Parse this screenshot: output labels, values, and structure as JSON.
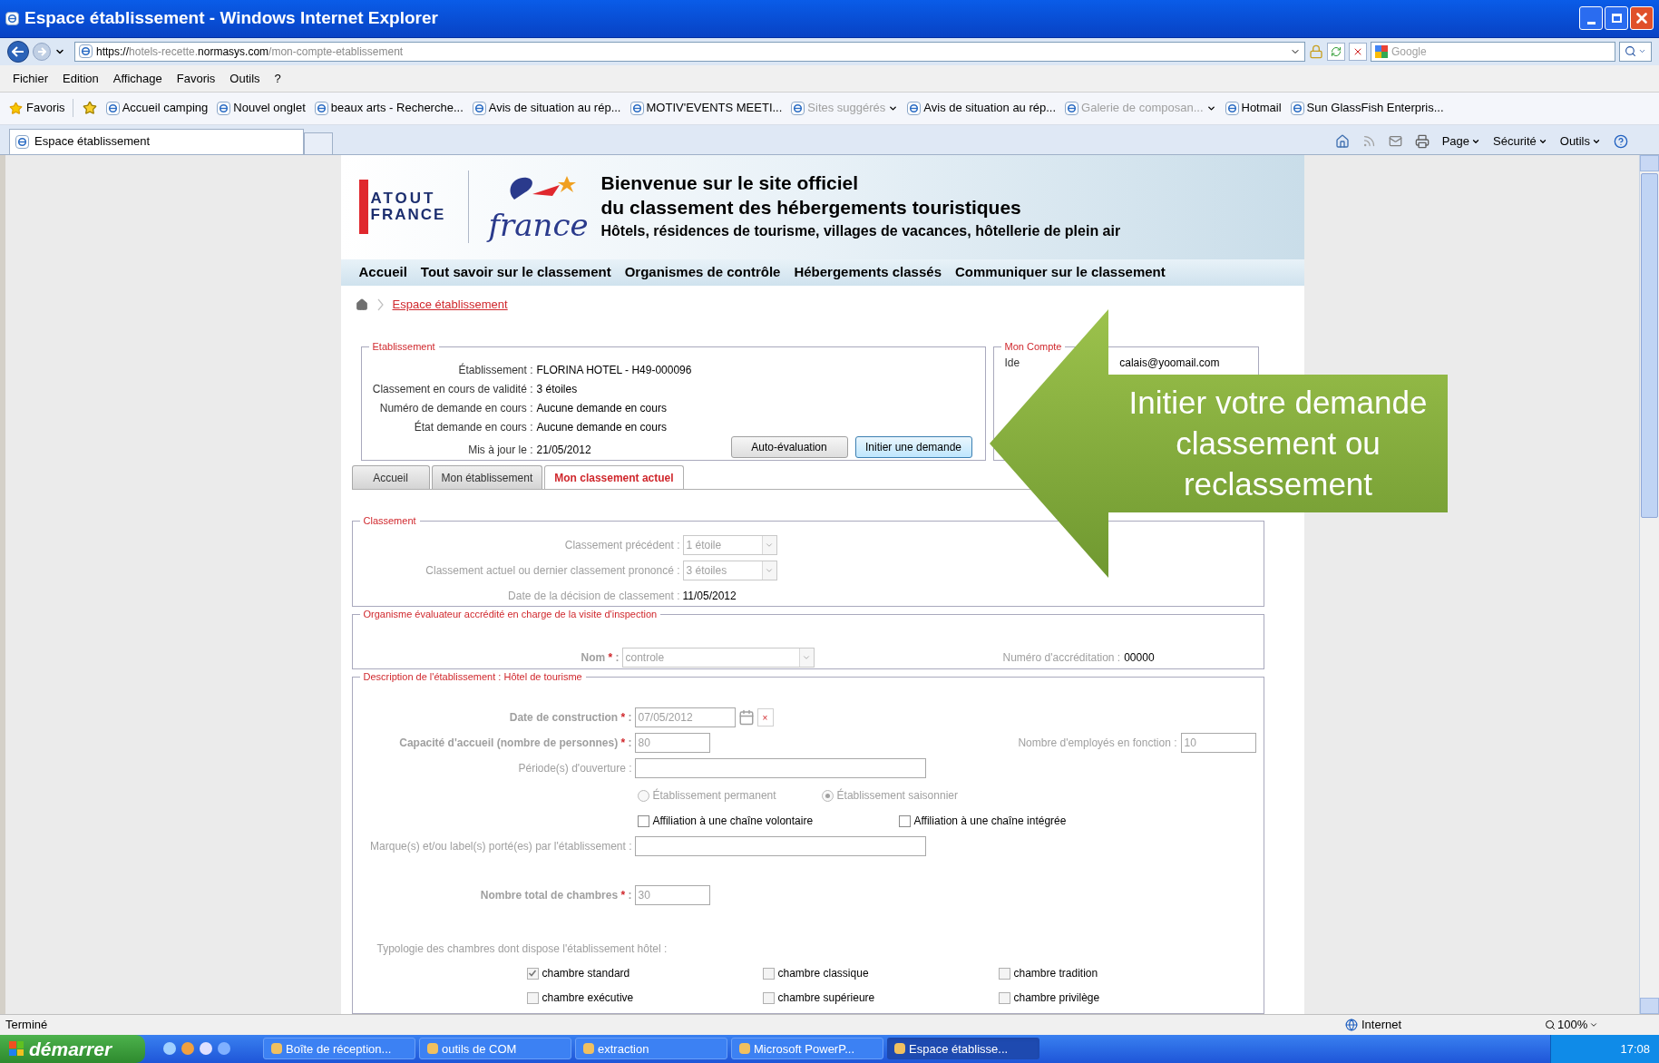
{
  "window": {
    "title": "Espace établissement - Windows Internet Explorer"
  },
  "address_bar": {
    "url_parts": [
      {
        "text": "https://",
        "dim": false
      },
      {
        "text": "hotels-recette.",
        "dim": true
      },
      {
        "text": "normasys.com",
        "dim": false
      },
      {
        "text": "/mon-compte-etablissement",
        "dim": true
      }
    ],
    "search_placeholder": "Google"
  },
  "menu": [
    "Fichier",
    "Edition",
    "Affichage",
    "Favoris",
    "Outils",
    "?"
  ],
  "favorites_bar": {
    "label": "Favoris",
    "items": [
      {
        "label": "Accueil camping",
        "disabled": false,
        "dropdown": false
      },
      {
        "label": "Nouvel onglet",
        "disabled": false,
        "dropdown": false
      },
      {
        "label": "beaux arts - Recherche...",
        "disabled": false,
        "dropdown": false
      },
      {
        "label": "Avis de situation au rép...",
        "disabled": false,
        "dropdown": false
      },
      {
        "label": "MOTIV'EVENTS MEETI...",
        "disabled": false,
        "dropdown": false
      },
      {
        "label": "Sites suggérés",
        "disabled": true,
        "dropdown": true
      },
      {
        "label": "Avis de situation au rép...",
        "disabled": false,
        "dropdown": false
      },
      {
        "label": "Galerie de composan...",
        "disabled": true,
        "dropdown": true
      },
      {
        "label": "Hotmail",
        "disabled": false,
        "dropdown": false
      },
      {
        "label": "Sun GlassFish Enterpris...",
        "disabled": false,
        "dropdown": false
      }
    ]
  },
  "browser_tabs": [
    {
      "label": "Espace établissement",
      "selected": true
    }
  ],
  "command_bar": [
    "Page",
    "Sécurité",
    "Outils"
  ],
  "site": {
    "logo": {
      "line_1": "ATOUT",
      "line_2": "FRANCE",
      "script": "france"
    },
    "header_lines": [
      "Bienvenue sur le site officiel",
      "du classement des hébergements touristiques",
      "Hôtels, résidences de tourisme, villages de vacances, hôtellerie de plein air"
    ],
    "nav": [
      "Accueil",
      "Tout savoir sur le classement",
      "Organismes de contrôle",
      "Hébergements classés",
      "Communiquer sur le classement"
    ],
    "breadcrumb": "Espace établissement",
    "etablissement": {
      "legend": "Etablissement",
      "rows": [
        {
          "label": "Établissement :",
          "value": "FLORINA HOTEL - H49-000096"
        },
        {
          "label": "Classement en cours de validité :",
          "value": "3 étoiles"
        },
        {
          "label": "Numéro de demande en cours :",
          "value": "Aucune demande en cours"
        },
        {
          "label": "État demande en cours :",
          "value": "Aucune demande en cours"
        },
        {
          "label": "Mis à jour le :",
          "value": "21/05/2012"
        }
      ],
      "buttons": [
        {
          "label": "Auto-évaluation",
          "focused": false
        },
        {
          "label": "Initier une demande",
          "focused": true
        }
      ]
    },
    "mon_compte": {
      "legend": "Mon Compte",
      "label_fragment": "Ide",
      "value_fragment": "calais@yoomail.com"
    },
    "tabs": [
      {
        "label": "Accueil",
        "selected": false
      },
      {
        "label": "Mon établissement",
        "selected": false
      },
      {
        "label": "Mon classement actuel",
        "selected": true
      }
    ],
    "classement": {
      "legend": "Classement",
      "rows": [
        {
          "kind": "select",
          "label": "Classement précédent :",
          "value": "1 étoile"
        },
        {
          "kind": "select",
          "label": "Classement actuel ou dernier classement prononcé :",
          "value": "3 étoiles"
        },
        {
          "kind": "text",
          "label": "Date de la décision de classement :",
          "value": "11/05/2012"
        }
      ]
    },
    "organisme": {
      "legend": "Organisme évaluateur accrédité en charge de la visite d'inspection",
      "name_label": "Nom",
      "required_mark": "*",
      "colon": ":",
      "name_value": "controle",
      "accreditation_label": "Numéro d'accréditation :",
      "accreditation_value": "00000"
    },
    "description": {
      "legend": "Description de l'établissement : Hôtel de tourisme",
      "construction": {
        "label": "Date de construction",
        "value": "07/05/2012",
        "clear": "×"
      },
      "capacity": {
        "label": "Capacité d'accueil (nombre de personnes)",
        "value": "80"
      },
      "employees": {
        "label": "Nombre d'employés en fonction :",
        "value": "10"
      },
      "opening": {
        "label": "Période(s) d'ouverture :"
      },
      "radios": [
        {
          "label": "Établissement permanent",
          "selected": false
        },
        {
          "label": "Établissement saisonnier",
          "selected": true
        }
      ],
      "affiliations": [
        {
          "label": "Affiliation à une chaîne volontaire",
          "checked": false
        },
        {
          "label": "Affiliation à une chaîne intégrée",
          "checked": false
        }
      ],
      "brands": {
        "label": "Marque(s) et/ou label(s) porté(es) par l'établissement :"
      },
      "rooms_total": {
        "label": "Nombre total de chambres",
        "value": "30"
      },
      "required_mark": "*",
      "colon": ":",
      "typology_label": "Typologie des chambres dont dispose l'établissement hôtel :",
      "room_types": [
        {
          "label": "chambre standard",
          "checked": true
        },
        {
          "label": "chambre classique",
          "checked": false
        },
        {
          "label": "chambre tradition",
          "checked": false
        },
        {
          "label": "chambre exécutive",
          "checked": false
        },
        {
          "label": "chambre supérieure",
          "checked": false
        },
        {
          "label": "chambre privilège",
          "checked": false
        }
      ]
    }
  },
  "callout": {
    "text": "Initier votre demande\nclassement  ou\nreclassement"
  },
  "status_bar": {
    "text": "Terminé",
    "zone": "Internet",
    "zoom": "100%"
  },
  "taskbar": {
    "start": "démarrer",
    "tasks": [
      {
        "label": "Boîte de réception...",
        "selected": false
      },
      {
        "label": "outils de COM",
        "selected": false
      },
      {
        "label": "extraction",
        "selected": false
      },
      {
        "label": "Microsoft PowerP...",
        "selected": false
      },
      {
        "label": "Espace établisse...",
        "selected": true
      }
    ],
    "clock": "17:08"
  }
}
